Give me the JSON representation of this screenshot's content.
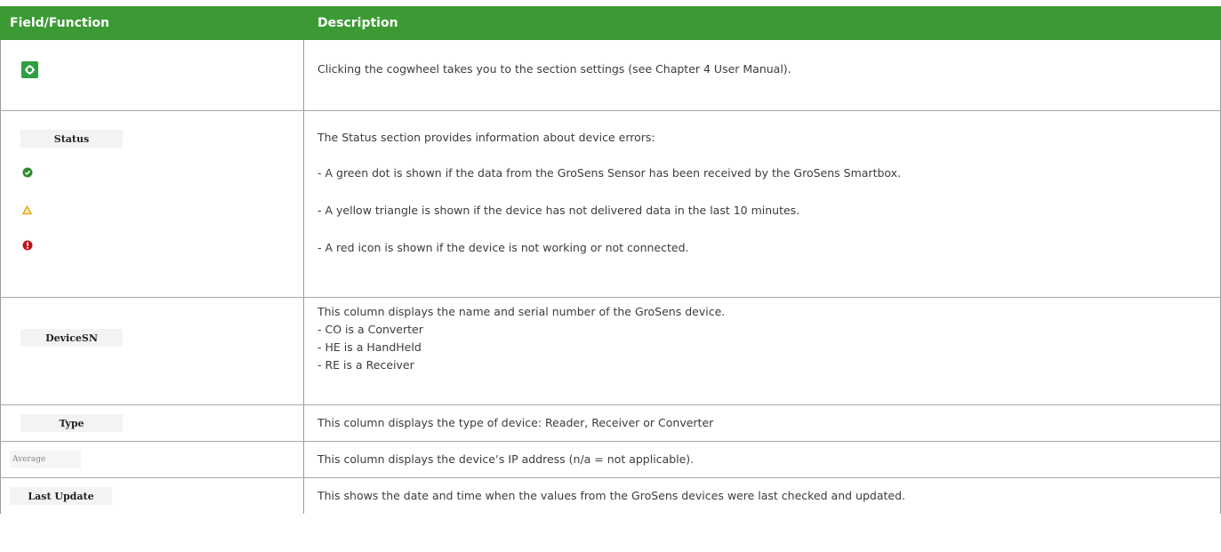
{
  "header": {
    "col1": "Field/Function",
    "col2": "Description"
  },
  "rows": {
    "settings": {
      "icon": "cogwheel-icon",
      "description": "Clicking the cogwheel takes you to the section settings (see Chapter 4 User Manual)."
    },
    "status": {
      "label": "Status",
      "intro": "The Status section provides information about device errors:",
      "green": "- A green dot is shown if the data from the GroSens Sensor has been received by the GroSens Smartbox.",
      "yellow": "- A yellow triangle is shown if the device has not delivered data in the last 10 minutes.",
      "red": "- A red icon is shown if the device is not working or not connected."
    },
    "devicesn": {
      "label": "DeviceSN",
      "line1": "This column displays the name and serial number of the GroSens device.",
      "line2": "- CO is a Converter",
      "line3": "- HE is a HandHeld",
      "line4": "- RE is a Receiver"
    },
    "type": {
      "label": "Type",
      "description": "This column displays the type of device: Reader, Receiver or Converter"
    },
    "average": {
      "label": "Average",
      "description": "This column displays the device’s IP address (n/a = not applicable)."
    },
    "lastupdate": {
      "label": "Last Update",
      "description": "This shows the date and time when the values from the GroSens devices were last checked and updated."
    }
  },
  "colors": {
    "header_green": "#3b9a34",
    "status_green": "#2e8b2e",
    "status_yellow": "#e8a91c",
    "status_red": "#c0141c"
  }
}
